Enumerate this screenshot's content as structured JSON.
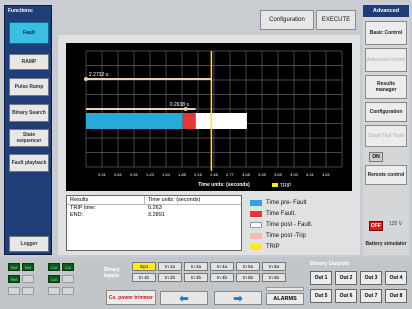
{
  "sidebar": {
    "title": "Functions:",
    "items": [
      "Fault",
      "RAMP",
      "Pulse Ramp",
      "Binary Search",
      "State sequencer",
      "Fault playback"
    ],
    "logger": "Logger"
  },
  "topbar": {
    "configuration": "Configuration",
    "execute": "EXECUTE"
  },
  "chart_data": {
    "type": "bar",
    "orientation": "horizontal-timeline",
    "x_ticks": [
      "0.31",
      "0.62",
      "0.92",
      "1.23",
      "1.54",
      "1.85",
      "2.16",
      "2.46",
      "2.77",
      "3.08",
      "3.39",
      "3.69",
      "4.00",
      "4.31",
      "4.62"
    ],
    "xlabel": "Time units: (seconds)",
    "xlim": [
      0,
      4.9
    ],
    "markers": [
      {
        "label": "2.2732 s.",
        "value": 2.2732
      },
      {
        "label": "0.2638 s.",
        "value": 0.2638
      }
    ],
    "trip_line": 2.4,
    "trip_label": "TRIP",
    "segments": [
      {
        "name": "Time pre- Fault",
        "start": 0,
        "end": 1.85,
        "color": "#2aa9d8"
      },
      {
        "name": "Time Fault.",
        "start": 1.85,
        "end": 2.1,
        "color": "#e23838"
      },
      {
        "name": "Time post - Fault",
        "start": 2.1,
        "end": 3.08,
        "color": "#ffffff"
      }
    ]
  },
  "results": {
    "header1": "Results",
    "header2": "Time units: (seconds)",
    "labels": [
      "TRIP time:",
      "END:"
    ],
    "values": [
      "0.263",
      "3.2891"
    ]
  },
  "legend": [
    {
      "label": "Time pre- Fault",
      "color": "#2aa9d8"
    },
    {
      "label": "Time Fault.",
      "color": "#e23838"
    },
    {
      "label": "Time post - Fault.",
      "color": "#ffffff"
    },
    {
      "label": "Time post -Trip",
      "color": "#f4b9b4"
    },
    {
      "label": "TRIP",
      "color": "#ffe61f"
    }
  ],
  "rightbar": {
    "title": "Advanced",
    "items": [
      "Basic Control",
      "Advanced control",
      "Results manager",
      "Configuration",
      "Smart Test Tools",
      "Remote control"
    ],
    "on": "ON",
    "off": "OFF",
    "voltage": "125 V",
    "battery": "Battery simulator"
  },
  "bottom": {
    "leds": [
      "Ref",
      "Ref",
      "Col",
      "Col",
      "Ref",
      "Col"
    ],
    "binary_inputs": "Binary Inputs",
    "inputs_row1": [
      "trip1",
      "In 2a",
      "In 3a",
      "In 4a",
      "In 5a",
      "In 6a"
    ],
    "inputs_row2": [
      "In 1b",
      "In 2b",
      "In 3b",
      "In 4b",
      "In 5b",
      "In 6b"
    ],
    "binary_outputs": "Binary Outputs",
    "outputs": [
      "Out 1",
      "Out 2",
      "Out 3",
      "Out 4",
      "Out 5",
      "Out 6",
      "Out 7",
      "Out 8"
    ],
    "power": "Cs. power trimmer",
    "alarms": "ALARMS"
  }
}
